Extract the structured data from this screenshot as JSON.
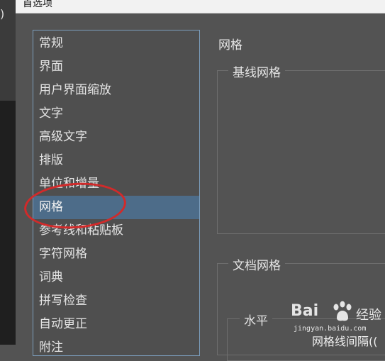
{
  "app": {
    "edge_glyph": ")"
  },
  "dialog": {
    "title": "首选项"
  },
  "categories": [
    {
      "label": "常规"
    },
    {
      "label": "界面"
    },
    {
      "label": "用户界面缩放"
    },
    {
      "label": "文字"
    },
    {
      "label": "高级文字"
    },
    {
      "label": "排版"
    },
    {
      "label": "单位和增量"
    },
    {
      "label": "网格",
      "selected": true
    },
    {
      "label": "参考线和粘贴板"
    },
    {
      "label": "字符网格"
    },
    {
      "label": "词典"
    },
    {
      "label": "拼写检查"
    },
    {
      "label": "自动更正"
    },
    {
      "label": "附注"
    }
  ],
  "panel": {
    "title": "网格",
    "baseline_grid": {
      "label": "基线网格"
    },
    "document_grid": {
      "label": "文档网格",
      "horizontal": {
        "label": "水平",
        "gridline_spacing_label": "网格线间隔(("
      }
    }
  },
  "annotation": {
    "color": "#d22a2a"
  },
  "watermark": {
    "logo_text": "Bai",
    "brand_text": "经验",
    "url": "jingyan.baidu.com"
  },
  "colors": {
    "selection": "#4d6c89",
    "list_border": "#7b9dbc",
    "panel_bg": "#535353"
  }
}
